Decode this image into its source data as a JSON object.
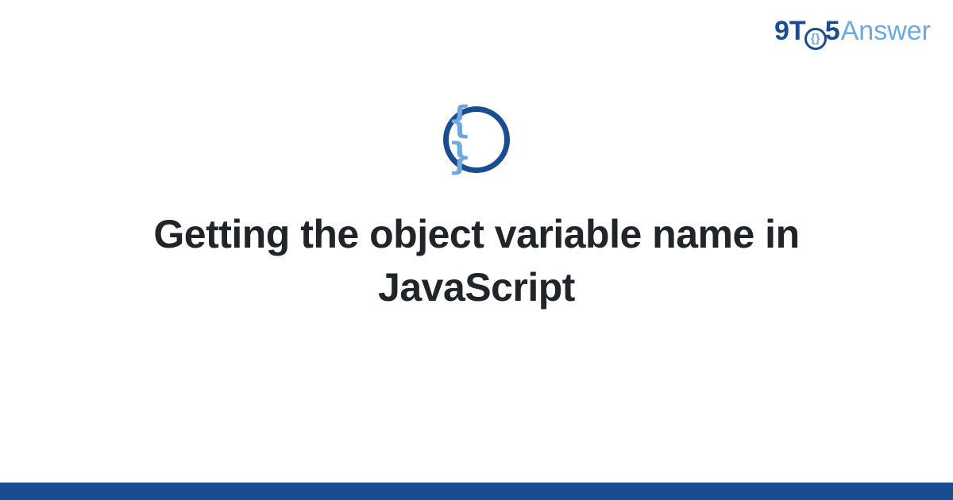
{
  "logo": {
    "part1": "9T",
    "circle_glyph": "{}",
    "part2": "5",
    "part3": "Answer"
  },
  "icon": {
    "glyph": "{ }"
  },
  "title": "Getting the object variable name in JavaScript",
  "colors": {
    "primary": "#1a4d8f",
    "accent": "#6fa8dc",
    "text": "#212529"
  }
}
